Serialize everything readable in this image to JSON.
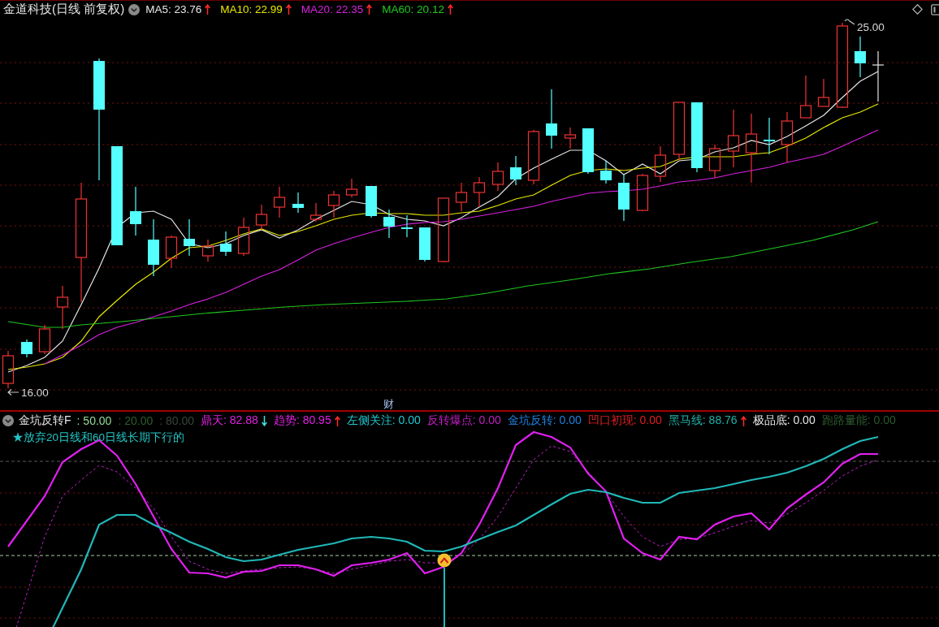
{
  "title_bar": {
    "title": "金道科技(日线 前复权)",
    "indicators": [
      {
        "label": "MA5: 23.76",
        "color": "#e6e6e6",
        "kind": "up"
      },
      {
        "label": "MA10: 22.99",
        "color": "#e8e800",
        "kind": "up"
      },
      {
        "label": "MA20: 22.35",
        "color": "#d820e0",
        "kind": "up"
      },
      {
        "label": "MA60: 20.12",
        "color": "#20c820",
        "kind": "up"
      }
    ]
  },
  "price_chart": {
    "high_label": "25.00",
    "low_label": "16.00",
    "marker": "财"
  },
  "indicator_panel": {
    "name": "金坑反转F",
    "params": [
      {
        "text": ": 50.00",
        "color": "#96dc96"
      },
      {
        "text": ": 20.00",
        "color": "#2e5e2e"
      },
      {
        "text": ": 80.00",
        "color": "#3a463a"
      }
    ],
    "values": [
      {
        "label": "鼎天: 82.88",
        "color": "#e020e0",
        "kind": "down"
      },
      {
        "label": "趋势: 80.95",
        "color": "#e020e0",
        "kind": "up"
      },
      {
        "label": "左侧关注: 0.00",
        "color": "#20c8d0",
        "kind": "plain"
      },
      {
        "label": "反转爆点: 0.00",
        "color": "#c020c0",
        "kind": "plain"
      },
      {
        "label": "金坑反转: 0.00",
        "color": "#2080e0",
        "kind": "plain"
      },
      {
        "label": "凹口初现: 0.00",
        "color": "#e02020",
        "kind": "plain"
      },
      {
        "label": "黑马线: 88.76",
        "color": "#20b0a8",
        "kind": "up"
      },
      {
        "label": "极品底: 0.00",
        "color": "#e6e6e6",
        "kind": "plain"
      },
      {
        "label": "跑路量能: 0.00",
        "color": "#2e5a2e",
        "kind": "plain"
      }
    ],
    "note": "★放弃20日线和60日线长期下行的"
  }
}
